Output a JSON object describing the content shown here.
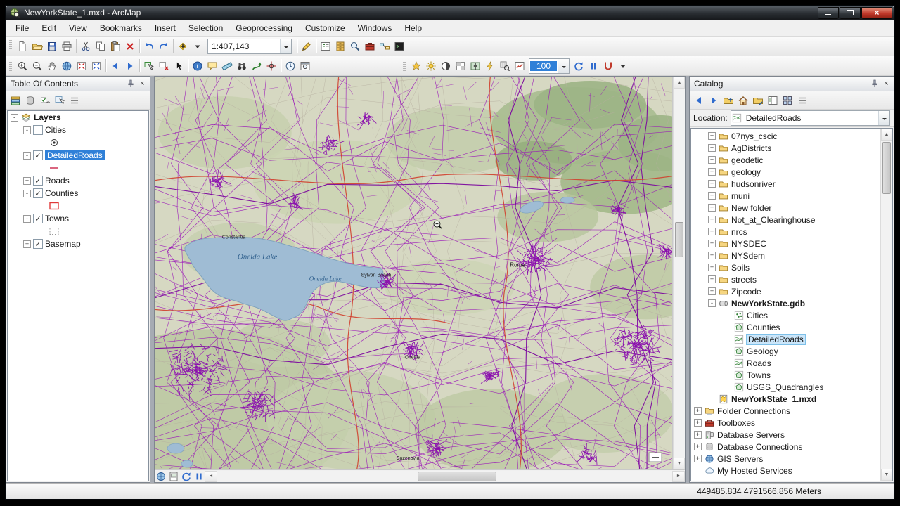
{
  "window": {
    "title": "NewYorkState_1.mxd - ArcMap"
  },
  "menubar": {
    "items": [
      "File",
      "Edit",
      "View",
      "Bookmarks",
      "Insert",
      "Selection",
      "Geoprocessing",
      "Customize",
      "Windows",
      "Help"
    ]
  },
  "toolbar_standard": {
    "groups": [
      [
        "new-document",
        "open-folder",
        "save",
        "print"
      ],
      [
        "cut",
        "copy",
        "paste",
        "delete"
      ],
      [
        "undo",
        "redo"
      ],
      [
        "add-data",
        "dropdown"
      ]
    ],
    "scale_value": "1:407,143",
    "groups_right": [
      [
        "editor"
      ],
      [
        "table-of-contents",
        "catalog",
        "search",
        "arctoolbox",
        "model-builder",
        "python-window"
      ]
    ]
  },
  "toolbar_tools": {
    "groups": [
      [
        "zoom-in",
        "zoom-out",
        "pan",
        "full-extent",
        "fixed-zoom-in",
        "fixed-zoom-out"
      ],
      [
        "back",
        "forward"
      ],
      [
        "select-features",
        "clear-selection",
        "select-elements"
      ],
      [
        "identify",
        "html-popup",
        "measure",
        "find",
        "find-route",
        "go-to-xy"
      ],
      [
        "time-slider",
        "viewer-window"
      ]
    ],
    "groups_right": [
      [
        "layer-effects",
        "brightness",
        "contrast",
        "transparency",
        "swipe",
        "flicker",
        "pixel-inspector",
        "image-analysis"
      ]
    ],
    "zoom_value": "100",
    "groups_end": [
      [
        "refresh-view",
        "pause-drawing",
        "snapping",
        "dropdown"
      ]
    ]
  },
  "toc": {
    "title": "Table Of Contents",
    "toolbar_icons": [
      "list-by-drawing-order",
      "list-by-source",
      "list-by-visibility",
      "list-by-selection",
      "options-menu"
    ],
    "root_label": "Layers",
    "root_expander": "-",
    "root_icon": "layers-group",
    "layers": [
      {
        "label": "Cities",
        "expander": "-",
        "check": "",
        "symbol": "point"
      },
      {
        "label": "DetailedRoads",
        "expander": "-",
        "check": "✓",
        "symbol": "line",
        "selected": true
      },
      {
        "label": "Roads",
        "expander": "+",
        "check": "✓"
      },
      {
        "label": "Counties",
        "expander": "-",
        "check": "✓",
        "symbol": "polygon-outline"
      },
      {
        "label": "Towns",
        "expander": "-",
        "check": "✓",
        "symbol": "dashed-outline"
      },
      {
        "label": "Basemap",
        "expander": "+",
        "check": "✓"
      }
    ]
  },
  "catalog": {
    "title": "Catalog",
    "toolbar_icons": [
      "back",
      "forward",
      "up-one-level",
      "home-folder",
      "connect-folder",
      "toggle-contents",
      "thumbnails",
      "options-menu"
    ],
    "location_label": "Location:",
    "location_icon": "fc-line",
    "location_value": "DetailedRoads",
    "items": [
      {
        "label": "07nys_cscic",
        "icon": "folder",
        "expander": "+"
      },
      {
        "label": "AgDistricts",
        "icon": "folder",
        "expander": "+"
      },
      {
        "label": "geodetic",
        "icon": "folder",
        "expander": "+"
      },
      {
        "label": "geology",
        "icon": "folder",
        "expander": "+"
      },
      {
        "label": "hudsonriver",
        "icon": "folder",
        "expander": "+"
      },
      {
        "label": "muni",
        "icon": "folder",
        "expander": "+"
      },
      {
        "label": "New folder",
        "icon": "folder",
        "expander": "+"
      },
      {
        "label": "Not_at_Clearinghouse",
        "icon": "folder",
        "expander": "+"
      },
      {
        "label": "nrcs",
        "icon": "folder",
        "expander": "+"
      },
      {
        "label": "NYSDEC",
        "icon": "folder",
        "expander": "+"
      },
      {
        "label": "NYSdem",
        "icon": "folder",
        "expander": "+"
      },
      {
        "label": "Soils",
        "icon": "folder",
        "expander": "+"
      },
      {
        "label": "streets",
        "icon": "folder",
        "expander": "+"
      },
      {
        "label": "Zipcode",
        "icon": "folder",
        "expander": "+"
      },
      {
        "label": "NewYorkState.gdb",
        "icon": "geodatabase",
        "expander": "-",
        "bold": true
      },
      {
        "label": "Cities",
        "icon": "fc-point",
        "expander": ""
      },
      {
        "label": "Counties",
        "icon": "fc-polygon",
        "expander": ""
      },
      {
        "label": "DetailedRoads",
        "icon": "fc-line",
        "expander": "",
        "selected": true
      },
      {
        "label": "Geology",
        "icon": "fc-polygon",
        "expander": ""
      },
      {
        "label": "Roads",
        "icon": "fc-line",
        "expander": ""
      },
      {
        "label": "Towns",
        "icon": "fc-polygon",
        "expander": ""
      },
      {
        "label": "USGS_Quadrangles",
        "icon": "fc-polygon",
        "expander": ""
      },
      {
        "label": "NewYorkState_1.mxd",
        "icon": "map-document",
        "expander": "",
        "bold": true
      },
      {
        "label": "Folder Connections",
        "icon": "folder-connections",
        "expander": "+"
      },
      {
        "label": "Toolboxes",
        "icon": "toolboxes",
        "expander": "+"
      },
      {
        "label": "Database Servers",
        "icon": "database-servers",
        "expander": "+"
      },
      {
        "label": "Database Connections",
        "icon": "database-connections",
        "expander": "+"
      },
      {
        "label": "GIS Servers",
        "icon": "gis-servers",
        "expander": "+"
      },
      {
        "label": "My Hosted Services",
        "icon": "hosted-services",
        "expander": ""
      }
    ]
  },
  "map": {
    "labels": {
      "constantia": "Constantia",
      "oneida_lake_1": "Oneida Lake",
      "oneida_lake_2": "Oneida Lake",
      "sylvan_beach": "Sylvan Beach",
      "rome": "Rome",
      "oneida": "Oneida",
      "cazenovia": "Cazenovia"
    }
  },
  "map_mini_icons": [
    "data-view",
    "layout-view",
    "refresh-view",
    "pause-drawing"
  ],
  "statusbar": {
    "coordinates": "449485.834 4791566.856 Meters"
  }
}
